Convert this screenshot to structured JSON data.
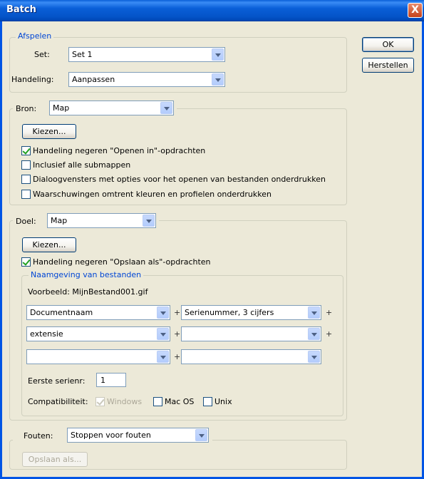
{
  "window": {
    "title": "Batch",
    "close_glyph": "X"
  },
  "buttons": {
    "ok": "OK",
    "reset": "Herstellen"
  },
  "playback": {
    "legend": "Afspelen",
    "set_label": "Set:",
    "set_value": "Set 1",
    "action_label": "Handeling:",
    "action_value": "Aanpassen"
  },
  "source": {
    "label": "Bron:",
    "value": "Map",
    "choose_button": "Kiezen...",
    "options": [
      {
        "label": "Handeling negeren \"Openen in\"-opdrachten",
        "checked": true
      },
      {
        "label": "Inclusief alle submappen",
        "checked": false
      },
      {
        "label": "Dialoogvensters met opties voor het openen van bestanden onderdrukken",
        "checked": false
      },
      {
        "label": "Waarschuwingen omtrent kleuren en profielen onderdrukken",
        "checked": false
      }
    ]
  },
  "destination": {
    "label": "Doel:",
    "value": "Map",
    "choose_button": "Kiezen...",
    "override_save": {
      "label": "Handeling negeren \"Opslaan als\"-opdrachten",
      "checked": true
    },
    "naming": {
      "legend": "Naamgeving van bestanden",
      "example": "Voorbeeld: MijnBestand001.gif",
      "fields": [
        [
          "Documentnaam",
          "Serienummer, 3 cijfers"
        ],
        [
          "extensie",
          ""
        ],
        [
          "",
          ""
        ]
      ],
      "plus": "+",
      "start_serial_label": "Eerste serienr:",
      "start_serial_value": "1",
      "compat_label": "Compatibiliteit:",
      "compat": [
        {
          "label": "Windows",
          "checked": true,
          "disabled": true
        },
        {
          "label": "Mac OS",
          "checked": false,
          "disabled": false
        },
        {
          "label": "Unix",
          "checked": false,
          "disabled": false
        }
      ]
    }
  },
  "errors": {
    "label": "Fouten:",
    "value": "Stoppen voor fouten",
    "save_as_button": "Opslaan als..."
  }
}
